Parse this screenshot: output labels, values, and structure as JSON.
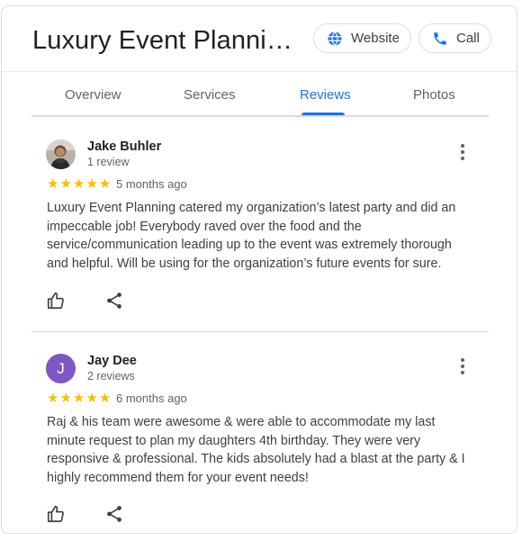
{
  "header": {
    "title": "Luxury Event Plannin…",
    "website_label": "Website",
    "call_label": "Call",
    "accent": "#1a73e8"
  },
  "tabs": [
    {
      "label": "Overview",
      "active": false
    },
    {
      "label": "Services",
      "active": false
    },
    {
      "label": "Reviews",
      "active": true
    },
    {
      "label": "Photos",
      "active": false
    }
  ],
  "reviews": [
    {
      "name": "Jake Buhler",
      "count": "1 review",
      "stars": 5,
      "date": "5 months ago",
      "text": "Luxury Event Planning catered my organization’s latest party and did an impeccable job! Everybody raved over the food and the service/communication leading up to the event was extremely thorough and helpful. Will be using for the organization’s future events for sure.",
      "avatar": "photo"
    },
    {
      "name": "Jay Dee",
      "count": "2 reviews",
      "stars": 5,
      "date": "6 months ago",
      "text": "Raj & his team were awesome & were able to accommodate my last minute request to plan my daughters 4th birthday. They were very responsive & professional. The kids absolutely had a blast at the party & I highly recommend them for your event needs!",
      "avatar_letter": "J",
      "avatar_color": "#7e57c2"
    }
  ],
  "icons": {
    "website": "globe-icon",
    "call": "phone-icon",
    "more": "more-vert-icon",
    "like": "thumb-up-icon",
    "share": "share-icon",
    "star": "star-icon"
  }
}
